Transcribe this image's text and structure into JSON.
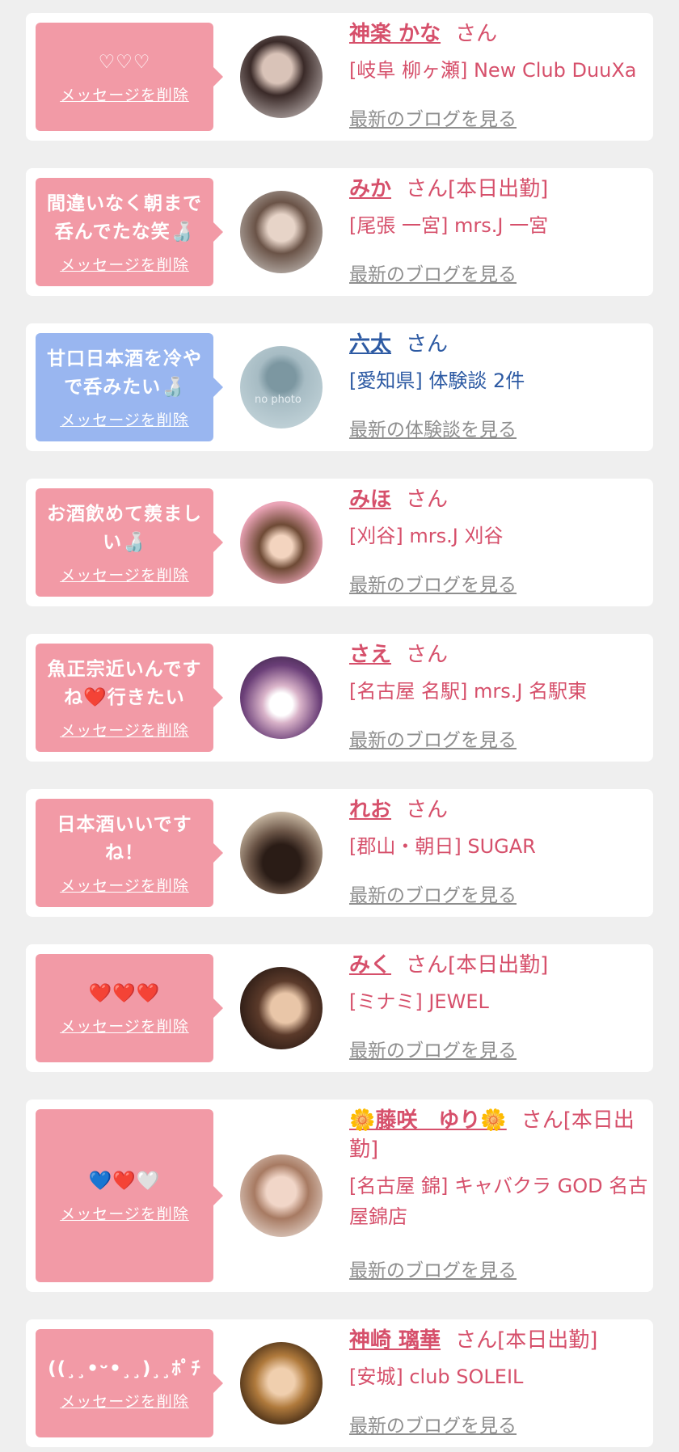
{
  "items": [
    {
      "message": "♡♡♡",
      "delete_label": "メッセージを削除",
      "name": "神楽 かな",
      "honorific": "さん",
      "shop": "[岐阜 柳ヶ瀬] New Club DuuXa",
      "link_label": "最新のブログを見る"
    },
    {
      "message": "間違いなく朝まで呑んでたな笑🍶",
      "delete_label": "メッセージを削除",
      "name": "みか",
      "honorific": "さん[本日出勤]",
      "shop": "[尾張 一宮] mrs.J 一宮",
      "link_label": "最新のブログを見る"
    },
    {
      "message": "甘口日本酒を冷やで呑みたい🍶",
      "delete_label": "メッセージを削除",
      "name": "六太",
      "honorific": "さん",
      "shop": "[愛知県] 体験談 2件",
      "link_label": "最新の体験談を見る",
      "avatar_text": "no photo"
    },
    {
      "message": "お酒飲めて羨ましい🍶",
      "delete_label": "メッセージを削除",
      "name": "みほ",
      "honorific": "さん",
      "shop": "[刈谷] mrs.J 刈谷",
      "link_label": "最新のブログを見る"
    },
    {
      "message": "魚正宗近いんですね❤️行きたい",
      "delete_label": "メッセージを削除",
      "name": "さえ",
      "honorific": "さん",
      "shop": "[名古屋 名駅] mrs.J 名駅東",
      "link_label": "最新のブログを見る"
    },
    {
      "message": "日本酒いいですね！",
      "delete_label": "メッセージを削除",
      "name": "れお",
      "honorific": "さん",
      "shop": "[郡山・朝日] SUGAR",
      "link_label": "最新のブログを見る"
    },
    {
      "message": "❤️❤️❤️",
      "delete_label": "メッセージを削除",
      "name": "みく",
      "honorific": "さん[本日出勤]",
      "shop": "[ミナミ] JEWEL",
      "link_label": "最新のブログを見る"
    },
    {
      "message": "💙❤️🤍",
      "delete_label": "メッセージを削除",
      "name": "🌼藤咲　ゆり🌼",
      "honorific": "さん[本日出勤]",
      "shop": "[名古屋 錦] キャバクラ GOD 名古屋錦店",
      "link_label": "最新のブログを見る"
    },
    {
      "message": "((¸¸•ᵕ•¸¸)¸¸ﾎﾟﾁ",
      "delete_label": "メッセージを削除",
      "name": "神崎 璃華",
      "honorific": "さん[本日出勤]",
      "shop": "[安城] club SOLEIL",
      "link_label": "最新のブログを見る"
    }
  ]
}
